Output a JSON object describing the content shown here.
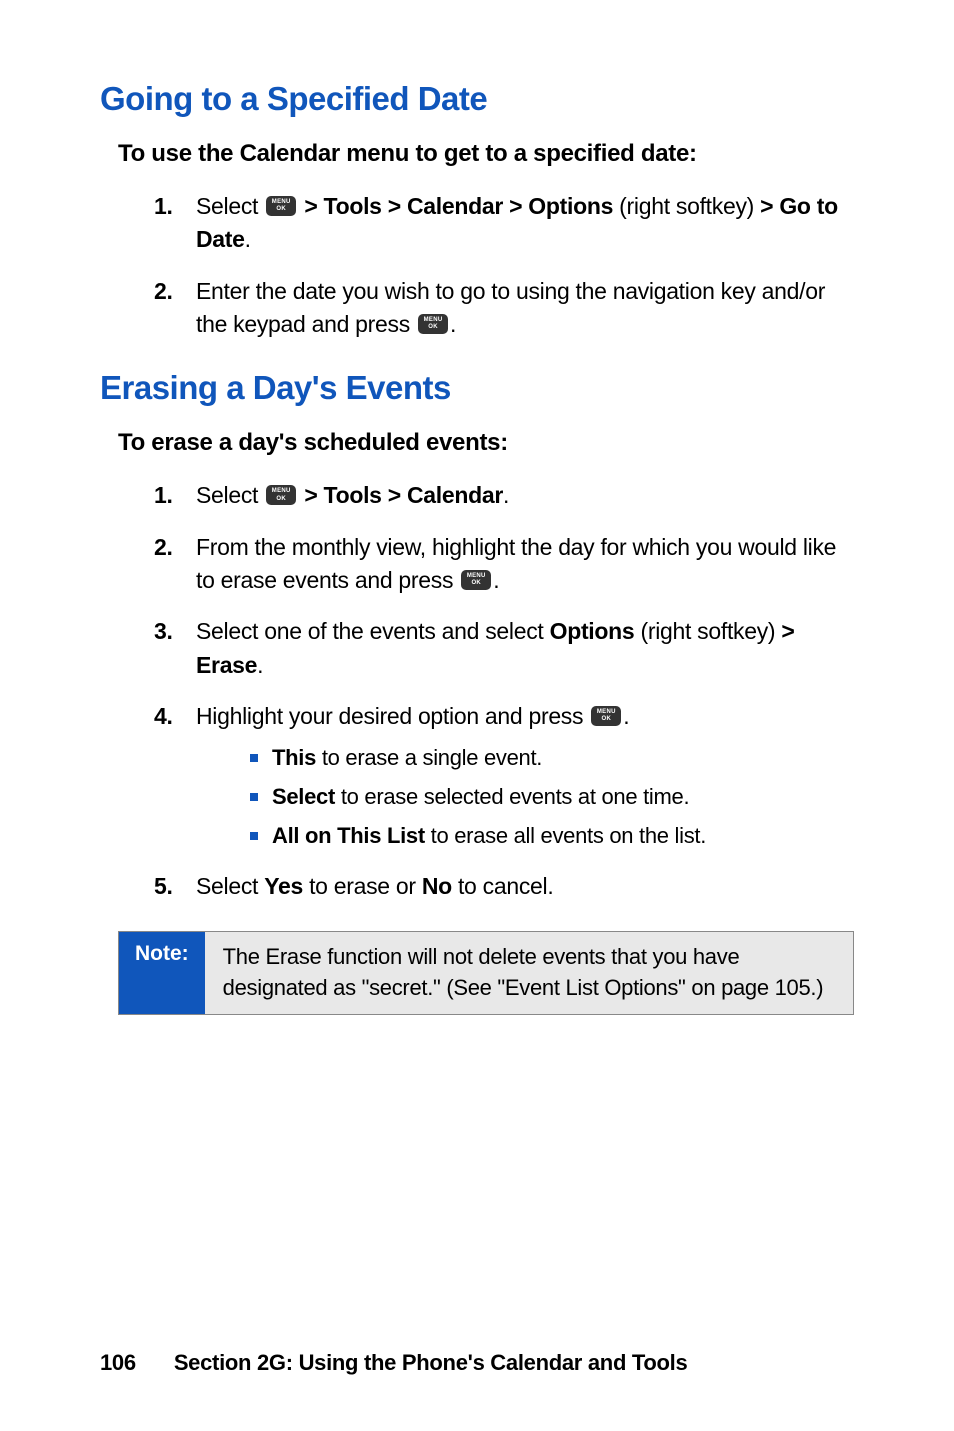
{
  "section1": {
    "heading": "Going to a Specified Date",
    "subheading": "To use the Calendar menu to get to a specified date:",
    "steps": [
      {
        "num": "1.",
        "pre": "Select ",
        "key": true,
        "mid": " ",
        "bold1": "> Tools > Calendar > Options",
        "plain1": " (right softkey) ",
        "bold2": "> Go to Date",
        "plain2": "."
      },
      {
        "num": "2.",
        "pre": "Enter the date you wish to go to using the navigation key and/or the keypad and press ",
        "key": true,
        "post": "."
      }
    ]
  },
  "section2": {
    "heading": "Erasing a Day's Events",
    "subheading": "To erase a day's scheduled events:",
    "steps": [
      {
        "num": "1.",
        "pre": "Select ",
        "key": true,
        "mid": " ",
        "bold1": "> Tools > Calendar",
        "plain1": "."
      },
      {
        "num": "2.",
        "pre": "From the monthly view, highlight the day for which you would like to erase events and press ",
        "key": true,
        "post": "."
      },
      {
        "num": "3.",
        "pre": "Select one of the events and select ",
        "bold1": "Options",
        "plain1": " (right softkey) ",
        "bold2": "> Erase",
        "plain2": "."
      },
      {
        "num": "4.",
        "pre": "Highlight your desired option and press ",
        "key": true,
        "post": ".",
        "bullets": [
          {
            "bold": "This",
            "plain": " to erase a single event."
          },
          {
            "bold": "Select",
            "plain": " to erase selected events at one time."
          },
          {
            "bold": "All on This List",
            "plain": " to erase all events on the list."
          }
        ]
      },
      {
        "num": "5.",
        "pre": "Select ",
        "bold1": "Yes",
        "plain1": " to erase or ",
        "bold2": "No",
        "plain2": " to cancel."
      }
    ]
  },
  "note": {
    "label": "Note:",
    "text": "The Erase function will not delete events that you have designated as \"secret.\" (See \"Event List Options\" on page 105.)"
  },
  "footer": {
    "page": "106",
    "section": "Section 2G: Using the Phone's Calendar and Tools"
  }
}
